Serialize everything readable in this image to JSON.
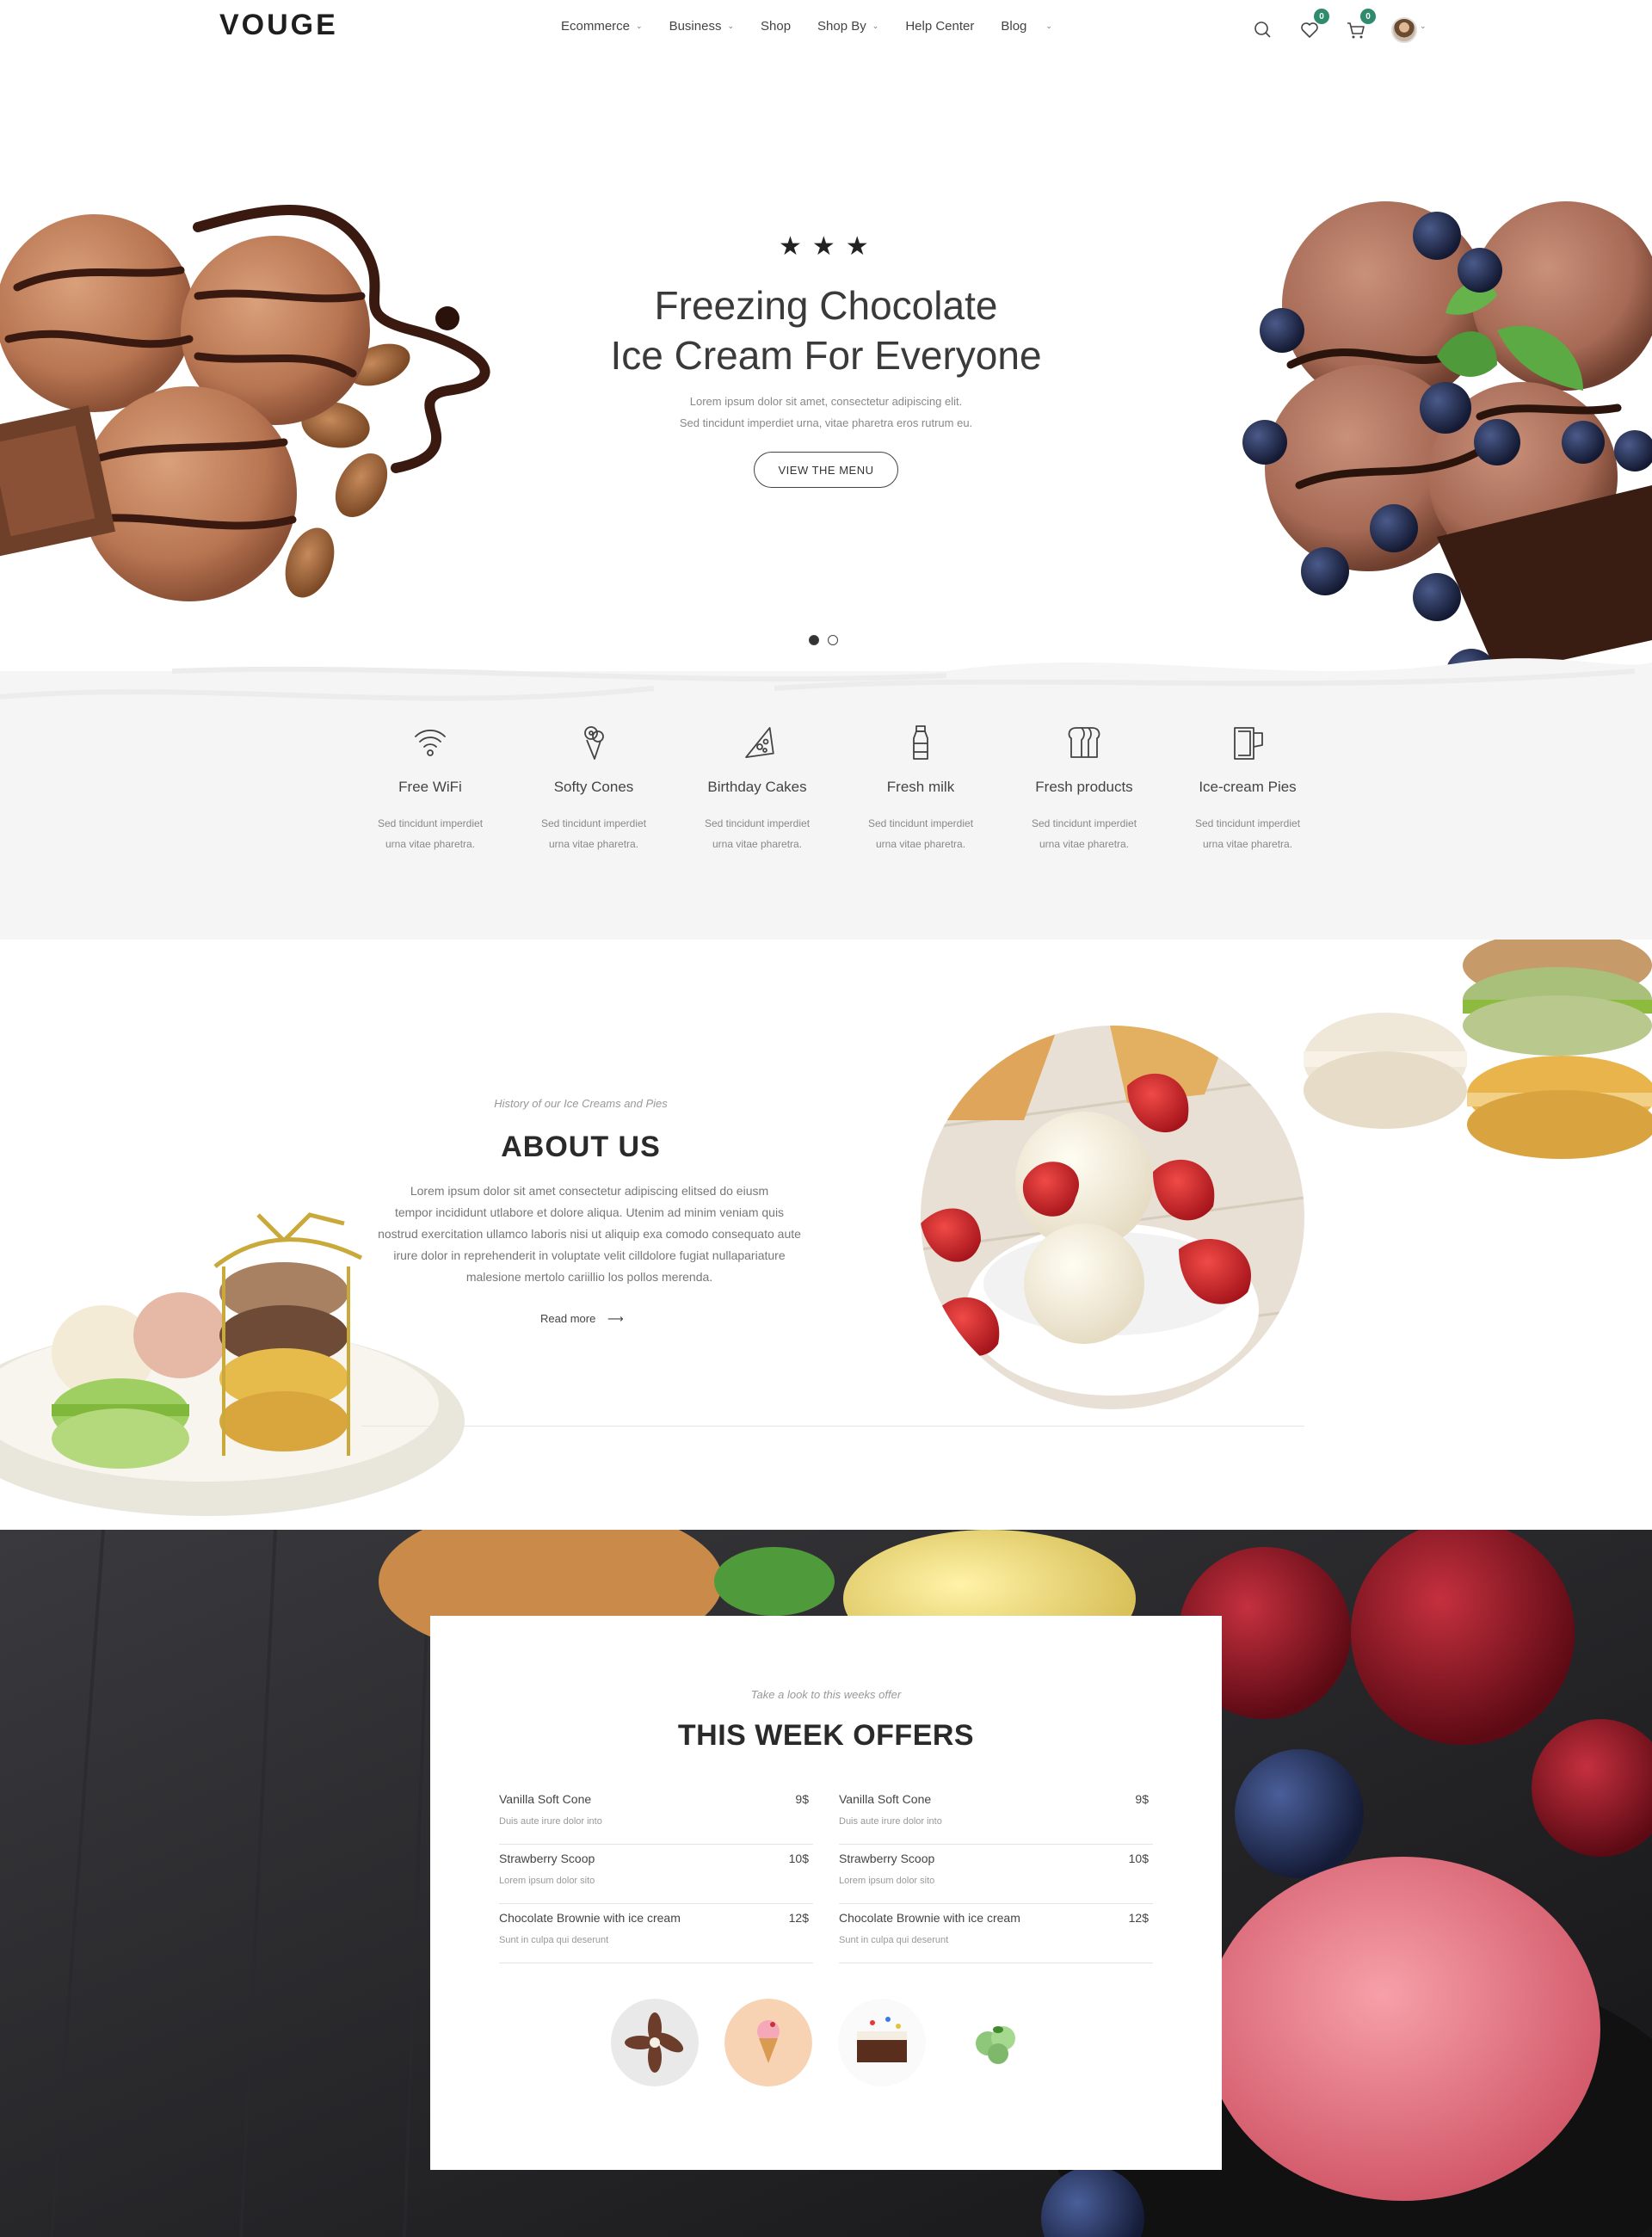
{
  "header": {
    "logo": "VOUGE",
    "nav": [
      {
        "label": "Ecommerce",
        "caret": true
      },
      {
        "label": "Business",
        "caret": true
      },
      {
        "label": "Shop",
        "caret": false
      },
      {
        "label": "Shop By",
        "caret": true
      },
      {
        "label": "Help Center",
        "caret": false
      },
      {
        "label": "Blog",
        "caret": true
      }
    ],
    "wishlist_count": "0",
    "cart_count": "0"
  },
  "hero": {
    "stars": "★★★",
    "title_line1": "Freezing Chocolate",
    "title_line2": "Ice Cream For Everyone",
    "sub_line1": "Lorem ipsum dolor sit amet, consectetur adipiscing elit.",
    "sub_line2": "Sed tincidunt imperdiet urna, vitae pharetra eros rutrum eu.",
    "button": "VIEW THE MENU",
    "slides": 2,
    "active_slide": 1
  },
  "features": [
    {
      "icon": "wifi-icon",
      "title": "Free WiFi",
      "desc1": "Sed tincidunt imperdiet",
      "desc2": "urna vitae pharetra."
    },
    {
      "icon": "ice-cream-cone-icon",
      "title": "Softy Cones",
      "desc1": "Sed tincidunt imperdiet",
      "desc2": "urna vitae pharetra."
    },
    {
      "icon": "cake-slice-icon",
      "title": "Birthday Cakes",
      "desc1": "Sed tincidunt imperdiet",
      "desc2": "urna vitae pharetra."
    },
    {
      "icon": "milk-bottle-icon",
      "title": "Fresh milk",
      "desc1": "Sed tincidunt imperdiet",
      "desc2": "urna vitae pharetra."
    },
    {
      "icon": "bread-icon",
      "title": "Fresh products",
      "desc1": "Sed tincidunt imperdiet",
      "desc2": "urna vitae pharetra."
    },
    {
      "icon": "pie-cup-icon",
      "title": "Ice-cream Pies",
      "desc1": "Sed tincidunt imperdiet",
      "desc2": "urna vitae pharetra."
    }
  ],
  "about": {
    "kicker": "History of our Ice Creams and Pies",
    "title": "ABOUT US",
    "line1": "Lorem ipsum dolor sit amet consectetur adipiscing elitsed do eiusm",
    "line2": "tempor incididunt utlabore et dolore aliqua. Utenim ad minim veniam quis",
    "line3": "nostrud exercitation ullamco laboris nisi ut aliquip exa comodo consequato aute",
    "line4": "irure dolor in reprehenderit in voluptate velit cilldolore fugiat nullapariature",
    "line5": "malesione mertolo cariillio los pollos merenda.",
    "read_more": "Read more",
    "arrow": "⟶"
  },
  "offers": {
    "kicker": "Take a look to this weeks offer",
    "title": "THIS WEEK OFFERS",
    "left": [
      {
        "name": "Vanilla Soft Cone",
        "price": "9$",
        "desc": "Duis aute irure dolor into"
      },
      {
        "name": "Strawberry Scoop",
        "price": "10$",
        "desc": "Lorem ipsum dolor sito"
      },
      {
        "name": "Chocolate Brownie with ice cream",
        "price": "12$",
        "desc": "Sunt in culpa qui deserunt"
      }
    ],
    "right": [
      {
        "name": "Vanilla Soft Cone",
        "price": "9$",
        "desc": "Duis aute irure dolor into"
      },
      {
        "name": "Strawberry Scoop",
        "price": "10$",
        "desc": "Lorem ipsum dolor sito"
      },
      {
        "name": "Chocolate Brownie with ice cream",
        "price": "12$",
        "desc": "Sunt in culpa qui deserunt"
      }
    ]
  },
  "colors": {
    "accent": "#2e8b6d",
    "text": "#333333",
    "muted": "#888888",
    "panel": "#f5f5f5"
  }
}
